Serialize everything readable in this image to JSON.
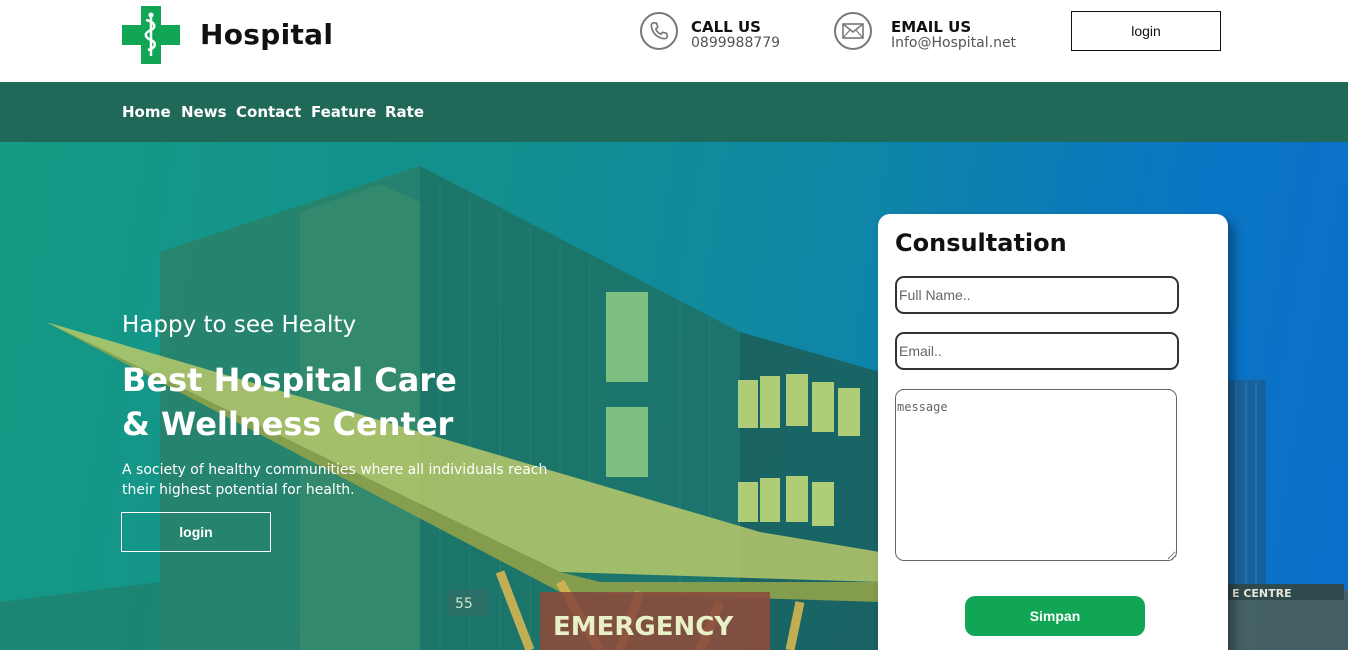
{
  "header": {
    "brand": "Hospital",
    "call": {
      "title": "CALL US",
      "value": "0899988779",
      "icon": "phone-icon"
    },
    "email": {
      "title": "EMAIL US",
      "value": "Info@Hospital.net",
      "icon": "envelope-icon"
    },
    "login_label": "login",
    "logo_icon": "medical-cross-caduceus-icon"
  },
  "nav": {
    "items": [
      {
        "label": "Home"
      },
      {
        "label": "News"
      },
      {
        "label": "Contact"
      },
      {
        "label": "Feature"
      },
      {
        "label": "Rate"
      }
    ]
  },
  "hero": {
    "subtitle": "Happy to see Healty",
    "title_line1": "Best Hospital Care",
    "title_line2": "& Wellness Center",
    "description": "A society of healthy communities where all individuals reach their highest potential for health.",
    "login_label": "login",
    "sign_emergency": "EMERGENCY",
    "sign_centre": "E CENTRE",
    "sign_number": "55"
  },
  "consultation": {
    "title": "Consultation",
    "name_placeholder": "Full Name..",
    "email_placeholder": "Email..",
    "message_placeholder": "message",
    "submit_label": "Simpan"
  },
  "colors": {
    "brand_green": "#10a655",
    "nav_bg": "#206857",
    "hero_gradient_start": "#159a84",
    "hero_gradient_end": "#0a6fca"
  }
}
